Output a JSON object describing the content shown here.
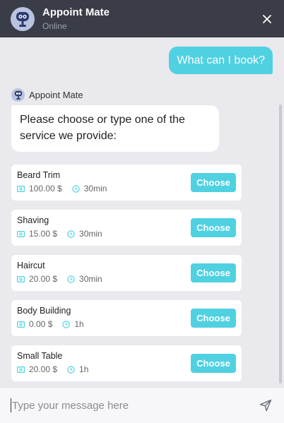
{
  "header": {
    "title": "Appoint Mate",
    "status": "Online"
  },
  "chat": {
    "user_message": "What can I book?",
    "bot_name": "Appoint Mate",
    "bot_message": "Please choose or type one of the service we provide:"
  },
  "services": [
    {
      "name": "Beard Trim",
      "price": "100.00 $",
      "duration": "30min",
      "button": "Choose"
    },
    {
      "name": "Shaving",
      "price": "15.00 $",
      "duration": "30min",
      "button": "Choose"
    },
    {
      "name": "Haircut",
      "price": "20.00 $",
      "duration": "30min",
      "button": "Choose"
    },
    {
      "name": "Body Building",
      "price": "0.00 $",
      "duration": "1h",
      "button": "Choose"
    },
    {
      "name": "Small Table",
      "price": "20.00 $",
      "duration": "1h",
      "button": "Choose"
    }
  ],
  "composer": {
    "placeholder": "Type your message here"
  },
  "colors": {
    "accent": "#4fd1e1",
    "header_bg": "#3a3d47",
    "chat_bg": "#e9e9ee"
  },
  "icons": {
    "avatar": "robot-avatar-icon",
    "close": "close-icon",
    "price": "money-icon",
    "duration": "clock-icon",
    "send": "send-icon"
  }
}
